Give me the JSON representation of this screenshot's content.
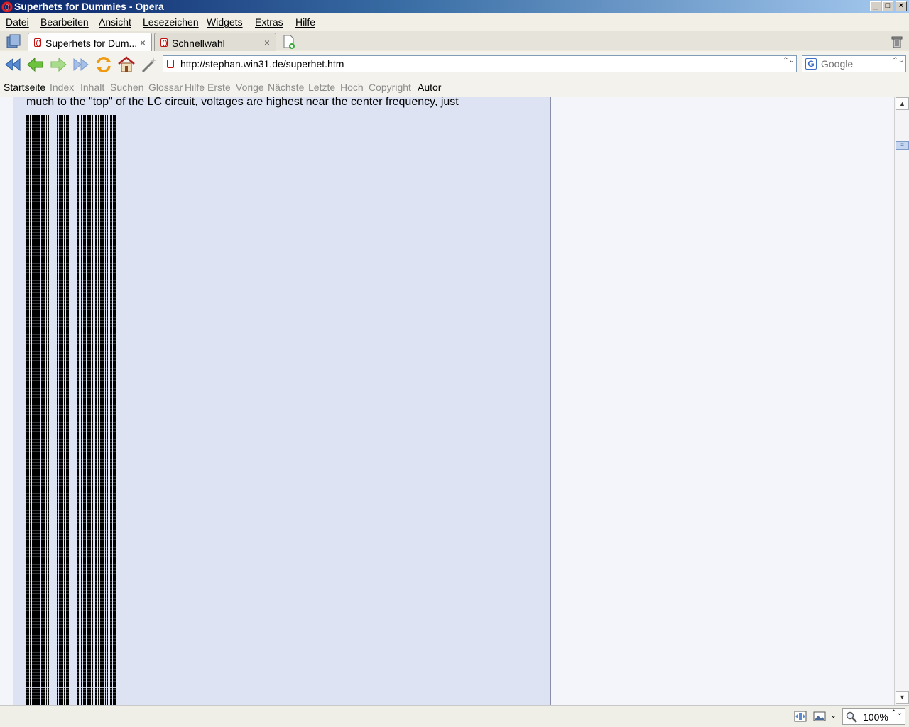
{
  "window": {
    "title": "Superhets for Dummies - Opera",
    "controls": {
      "minimize": "_",
      "maximize": "□",
      "close": "×"
    }
  },
  "menu": [
    {
      "label": "Datei"
    },
    {
      "label": "Bearbeiten"
    },
    {
      "label": "Ansicht"
    },
    {
      "label": "Lesezeichen"
    },
    {
      "label": "Widgets"
    },
    {
      "label": "Extras"
    },
    {
      "label": "Hilfe"
    }
  ],
  "tabs": [
    {
      "label": "Superhets for Dum...",
      "active": true,
      "close": "×"
    },
    {
      "label": "Schnellwahl",
      "active": false,
      "close": "×"
    }
  ],
  "address": {
    "url": "http://stephan.win31.de/superhet.htm",
    "dropdown": "⌃⌄"
  },
  "search": {
    "placeholder": "Google",
    "engine_letter": "G",
    "dropdown": "⌃⌄"
  },
  "navlinks": [
    {
      "label": "Startseite",
      "enabled": true
    },
    {
      "label": "Index",
      "enabled": false
    },
    {
      "label": "Inhalt",
      "enabled": false
    },
    {
      "label": "Suchen",
      "enabled": false
    },
    {
      "label": "Glossar",
      "enabled": false
    },
    {
      "label": "Hilfe",
      "enabled": false
    },
    {
      "label": "Erste",
      "enabled": false
    },
    {
      "label": "Vorige",
      "enabled": false
    },
    {
      "label": "Nächste",
      "enabled": false
    },
    {
      "label": "Letzte",
      "enabled": false
    },
    {
      "label": "Hoch",
      "enabled": false
    },
    {
      "label": "Copyright",
      "enabled": false
    },
    {
      "label": "Autor",
      "enabled": true
    }
  ],
  "content": {
    "text_line": "much to the \"top\" of the LC circuit, voltages are highest near the center frequency, just"
  },
  "scrollbar": {
    "up": "▲",
    "down": "▼",
    "thumb_grip": "≡"
  },
  "status": {
    "zoom": "100%",
    "zoom_dropdown": "⌃⌄",
    "image_dropdown": "⌄"
  },
  "colors": {
    "title_gradient_start": "#0a246a",
    "content_panel": "#dde3f3",
    "disabled_link": "#8c8c8c"
  }
}
